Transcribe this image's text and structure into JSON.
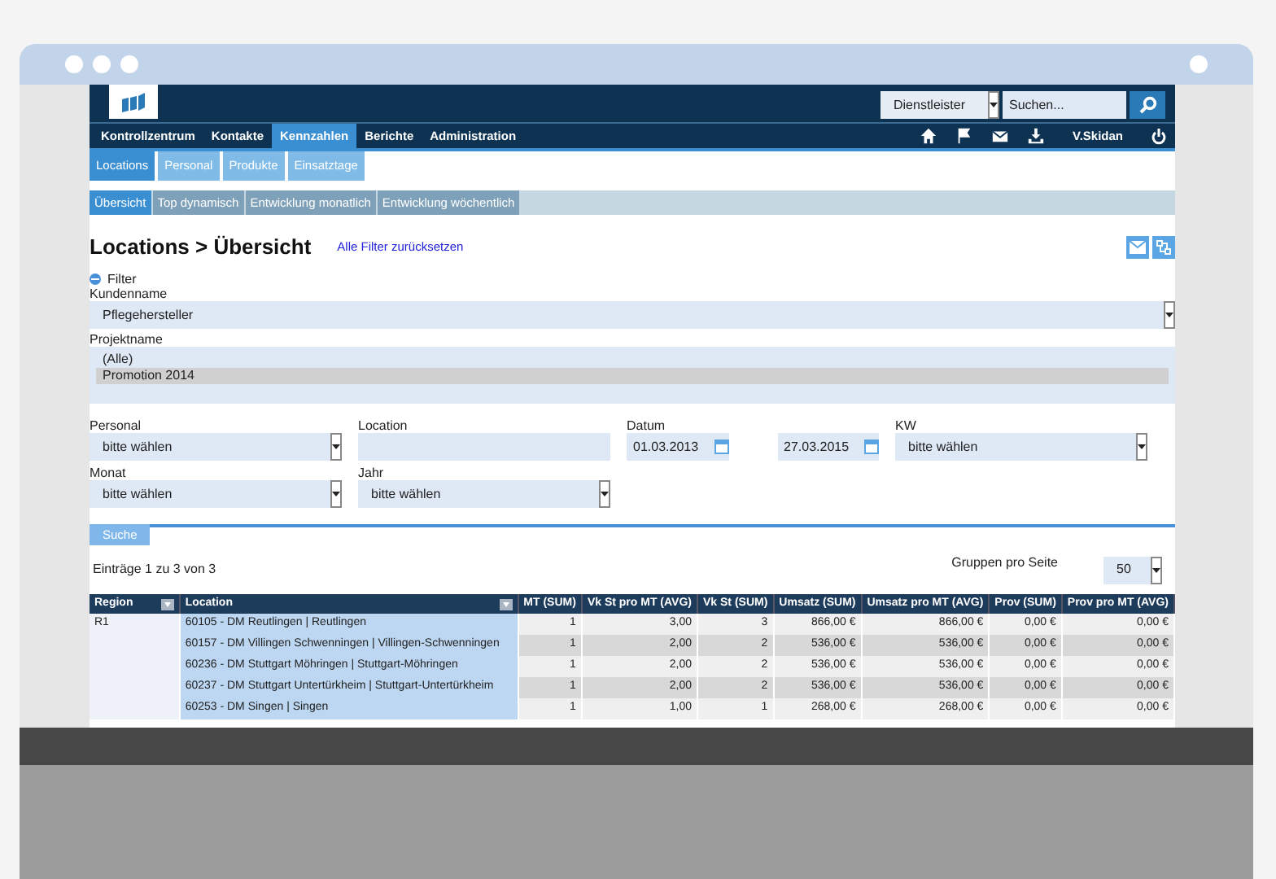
{
  "header": {
    "search_scope": "Dienstleister",
    "search": {
      "placeholder": "Suchen..."
    },
    "user": "V.Skidan"
  },
  "nav": [
    {
      "label": "Kontrollzentrum",
      "selected": false
    },
    {
      "label": "Kontakte",
      "selected": false
    },
    {
      "label": "Kennzahlen",
      "selected": true
    },
    {
      "label": "Berichte",
      "selected": false
    },
    {
      "label": "Administration",
      "selected": false
    }
  ],
  "subtabs": [
    {
      "label": "Locations",
      "selected": true
    },
    {
      "label": "Personal",
      "selected": false
    },
    {
      "label": "Produkte",
      "selected": false
    },
    {
      "label": "Einsatztage",
      "selected": false
    }
  ],
  "viewtabs": [
    {
      "label": "Übersicht",
      "selected": true
    },
    {
      "label": "Top dynamisch",
      "selected": false
    },
    {
      "label": "Entwicklung monatlich",
      "selected": false
    },
    {
      "label": "Entwicklung wöchentlich",
      "selected": false
    }
  ],
  "title": "Locations > Übersicht",
  "reset_link": "Alle Filter zurücksetzen",
  "filter": {
    "label": "Filter",
    "expanded": true,
    "kundenname": {
      "label": "Kundenname",
      "value": "Pflegehersteller"
    },
    "projektname": {
      "label": "Projektname",
      "options": [
        {
          "label": "(Alle)",
          "selected": false
        },
        {
          "label": "Promotion 2014",
          "selected": true
        }
      ]
    },
    "personal": {
      "label": "Personal",
      "value": "bitte wählen"
    },
    "location": {
      "label": "Location"
    },
    "datum": {
      "label": "Datum",
      "from": "01.03.2013",
      "to": "27.03.2015"
    },
    "kw": {
      "label": "KW",
      "value": "bitte wählen"
    },
    "monat": {
      "label": "Monat",
      "value": "bitte wählen"
    },
    "jahr": {
      "label": "Jahr",
      "value": "bitte wählen"
    }
  },
  "search_tab": "Suche",
  "entries": "Einträge 1 zu 3 von 3",
  "groups_label": "Gruppen pro Seite",
  "groups_value": "50",
  "table": {
    "columns": [
      "Region",
      "Location",
      "MT (SUM)",
      "Vk St pro MT (AVG)",
      "Vk St (SUM)",
      "Umsatz (SUM)",
      "Umsatz pro MT (AVG)",
      "Prov (SUM)",
      "Prov pro MT (AVG)"
    ],
    "rows": [
      [
        "R1",
        "60105 - DM Reutlingen | Reutlingen",
        "1",
        "3,00",
        "3",
        "866,00 €",
        "866,00 €",
        "0,00 €",
        "0,00 €"
      ],
      [
        "",
        "60157 - DM Villingen Schwenningen | Villingen-Schwenningen",
        "1",
        "2,00",
        "2",
        "536,00 €",
        "536,00 €",
        "0,00 €",
        "0,00 €"
      ],
      [
        "",
        "60236 - DM Stuttgart Möhringen | Stuttgart-Möhringen",
        "1",
        "2,00",
        "2",
        "536,00 €",
        "536,00 €",
        "0,00 €",
        "0,00 €"
      ],
      [
        "",
        "60237 - DM Stuttgart Untertürkheim | Stuttgart-Untertürkheim",
        "1",
        "2,00",
        "2",
        "536,00 €",
        "536,00 €",
        "0,00 €",
        "0,00 €"
      ],
      [
        "",
        "60253 - DM Singen | Singen",
        "1",
        "1,00",
        "1",
        "268,00 €",
        "268,00 €",
        "0,00 €",
        "0,00 €"
      ]
    ]
  }
}
